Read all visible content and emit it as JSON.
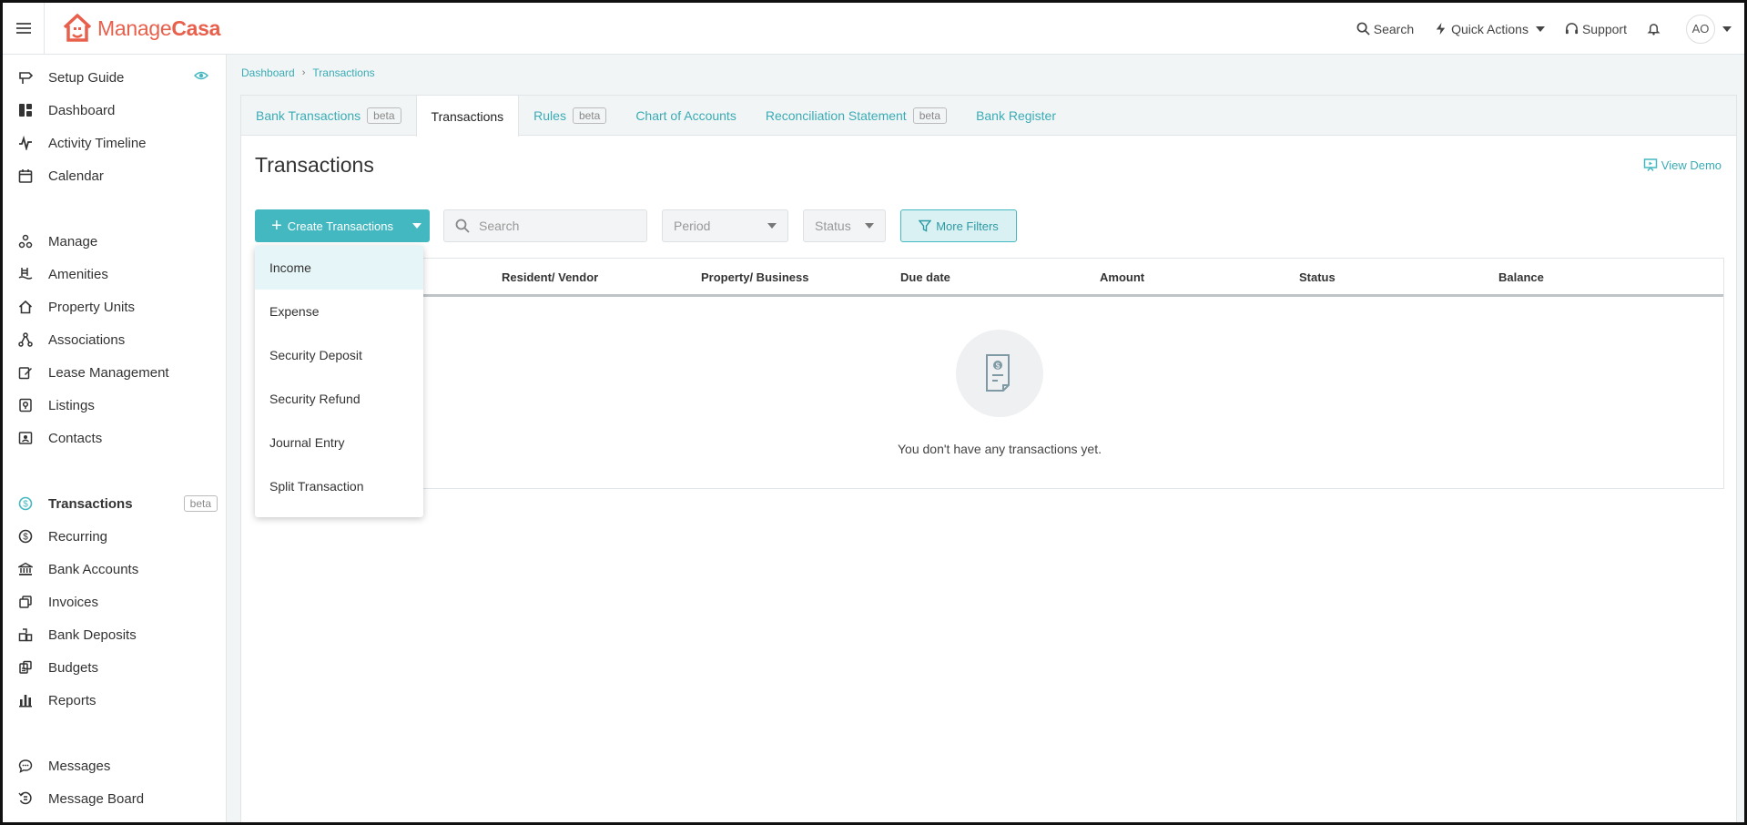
{
  "brand": {
    "name_part1": "Manage",
    "name_part2": "Casa",
    "color": "#e8604c"
  },
  "accent": "#44b8c0",
  "topnav": {
    "search": "Search",
    "quick_actions": "Quick Actions",
    "support": "Support",
    "avatar_initials": "AO"
  },
  "sidebar": {
    "setup_guide": "Setup Guide",
    "dashboard": "Dashboard",
    "activity_timeline": "Activity Timeline",
    "calendar": "Calendar",
    "manage": "Manage",
    "amenities": "Amenities",
    "property_units": "Property Units",
    "associations": "Associations",
    "lease_management": "Lease Management",
    "listings": "Listings",
    "contacts": "Contacts",
    "transactions": "Transactions",
    "transactions_badge": "beta",
    "recurring": "Recurring",
    "bank_accounts": "Bank Accounts",
    "invoices": "Invoices",
    "bank_deposits": "Bank Deposits",
    "budgets": "Budgets",
    "reports": "Reports",
    "messages": "Messages",
    "message_board": "Message Board"
  },
  "breadcrumb": {
    "root": "Dashboard",
    "sep": "›",
    "current": "Transactions"
  },
  "tabs": {
    "bank_transactions": "Bank Transactions",
    "bank_transactions_badge": "beta",
    "transactions": "Transactions",
    "rules": "Rules",
    "rules_badge": "beta",
    "chart_of_accounts": "Chart of Accounts",
    "reconciliation_statement": "Reconciliation Statement",
    "reconciliation_badge": "beta",
    "bank_register": "Bank Register"
  },
  "page": {
    "title": "Transactions",
    "view_demo": "View Demo"
  },
  "toolbar": {
    "create_label": "Create Transactions",
    "search_placeholder": "Search",
    "period_label": "Period",
    "status_label": "Status",
    "more_filters": "More Filters"
  },
  "table": {
    "columns": [
      "Resident/ Vendor",
      "Property/ Business",
      "Due date",
      "Amount",
      "Status",
      "Balance"
    ],
    "empty_text": "You don't have any transactions yet."
  },
  "create_menu": {
    "items": [
      "Income",
      "Expense",
      "Security Deposit",
      "Security Refund",
      "Journal Entry",
      "Split Transaction"
    ]
  }
}
